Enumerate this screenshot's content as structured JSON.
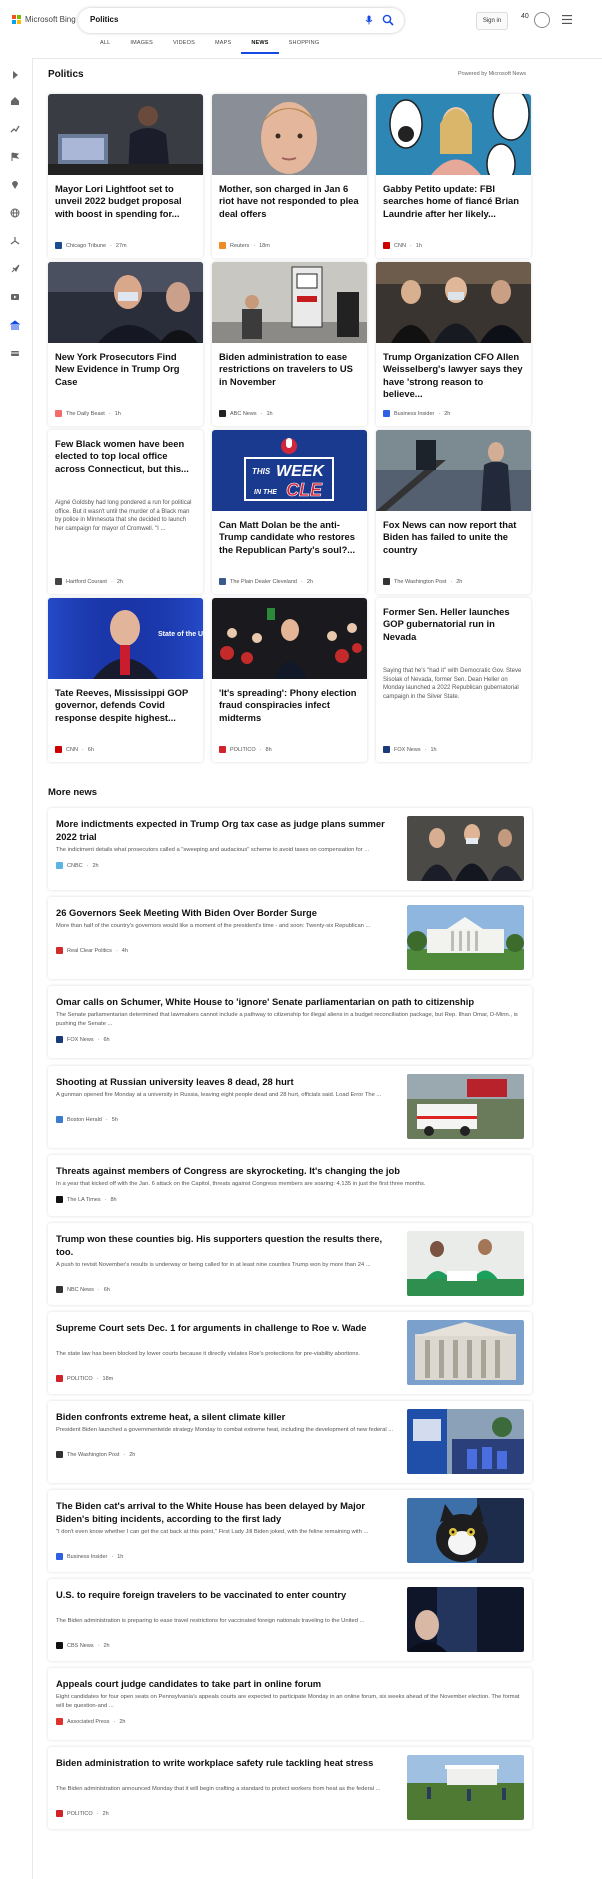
{
  "header": {
    "brand": "Microsoft Bing",
    "query": "Politics",
    "signin": "Sign in",
    "rewards_count": "40",
    "tabs": [
      "ALL",
      "IMAGES",
      "VIDEOS",
      "MAPS",
      "NEWS",
      "SHOPPING"
    ],
    "active_tab": "NEWS"
  },
  "section": {
    "title": "Politics",
    "powered_by": "Powered by Microsoft News"
  },
  "cards": [
    {
      "title": "Mayor Lori Lightfoot set to unveil 2022 budget proposal with boost in spending for...",
      "source": "Chicago Tribune",
      "time": "27m",
      "logo_color": "#1a4d8f",
      "image": "mayor"
    },
    {
      "title": "Mother, son charged in Jan 6 riot have not responded to plea deal offers",
      "source": "Reuters",
      "time": "18m",
      "logo_color": "#f08a24",
      "image": "mugshot"
    },
    {
      "title": "Gabby Petito update: FBI searches home of fiancé Brian Laundrie after her likely...",
      "source": "CNN",
      "time": "1h",
      "logo_color": "#cc0000",
      "image": "petito"
    },
    {
      "title": "New York Prosecutors Find New Evidence in Trump Org Case",
      "source": "The Daily Beast",
      "time": "1h",
      "logo_color": "#f26c6c",
      "image": "weisselberg"
    },
    {
      "title": "Biden administration to ease restrictions on travelers to US in November",
      "source": "ABC News",
      "time": "1h",
      "logo_color": "#222222",
      "image": "testing"
    },
    {
      "title": "Trump Organization CFO Allen Weisselberg's lawyer says they have 'strong reason to believe...",
      "source": "Business Insider",
      "time": "2h",
      "logo_color": "#2f5fe3",
      "image": "lawyers"
    },
    {
      "title": "Few Black women have been elected to top local office across Connecticut, but this...",
      "snippet": "Aigné Goldsby had long pondered a run for political office. But it wasn't until the murder of a Black man by police in Minnesota that she decided to launch her campaign for mayor of Cromwell. \"I ...",
      "source": "Hartford Courant",
      "time": "2h",
      "logo_color": "#444444",
      "image": "none"
    },
    {
      "title": "Can Matt Dolan be the anti-Trump candidate who restores the Republican Party's soul?...",
      "source": "The Plain Dealer Cleveland",
      "time": "2h",
      "logo_color": "#3a5a8c",
      "image": "weekcle",
      "image_text_1": "THIS",
      "image_text_2": "WEEK",
      "image_text_3": "IN THE",
      "image_text_4": "CLE"
    },
    {
      "title": "Fox News can now report that Biden has failed to unite the country",
      "source": "The Washington Post",
      "time": "2h",
      "logo_color": "#333333",
      "image": "biden_stairs"
    },
    {
      "title": "Tate Reeves, Mississippi GOP governor, defends Covid response despite highest...",
      "source": "CNN",
      "time": "6h",
      "logo_color": "#cc0000",
      "image": "stateunion",
      "image_text": "State of the UNION"
    },
    {
      "title": "'It's spreading': Phony election fraud conspiracies infect midterms",
      "source": "POLITICO",
      "time": "8h",
      "logo_color": "#d2232a",
      "image": "rally"
    },
    {
      "title": "Former Sen. Heller launches GOP gubernatorial run in Nevada",
      "snippet": "Saying that he's \"had it\" with Democratic Gov. Steve Sisolak of Nevada, former Sen. Dean Heller on Monday launched a 2022 Republican gubernatorial campaign in the Silver State.",
      "source": "FOX News",
      "time": "1h",
      "logo_color": "#1a3b7a",
      "image": "none"
    }
  ],
  "more_news": {
    "title": "More news",
    "items": [
      {
        "title": "More indictments expected in Trump Org tax case as judge plans summer 2022 trial",
        "snippet": "The indictment details what prosecutors called a \"sweeping and audacious\" scheme to avoid taxes on compensation for ...",
        "source": "CNBC",
        "time": "2h",
        "logo_color": "#5bb4e5",
        "thumb": "suits"
      },
      {
        "title": "26 Governors Seek Meeting With Biden Over Border Surge",
        "snippet": "More than half of the country's governors would like a moment of the president's time - and soon: Twenty-six Republican ...",
        "source": "Real Clear Politics",
        "time": "4h",
        "logo_color": "#d12b2b",
        "thumb": "whitehouse"
      },
      {
        "title": "Omar calls on Schumer, White House to 'ignore' Senate parliamentarian on path to citizenship",
        "snippet": "The Senate parliamentarian determined that lawmakers cannot include a pathway to citizenship for illegal aliens in a budget reconciliation package, but Rep. Ilhan Omar, D-Minn., is pushing the Senate ...",
        "source": "FOX News",
        "time": "6h",
        "logo_color": "#1a3b7a",
        "thumb": "none"
      },
      {
        "title": "Shooting at Russian university leaves 8 dead, 28 hurt",
        "snippet": "A gunman opened fire Monday at a university in Russia, leaving eight people dead and 28 hurt, officials said. Load Error The ...",
        "source": "Boston Herald",
        "time": "5h",
        "logo_color": "#3b7bd0",
        "thumb": "ambulance"
      },
      {
        "title": "Threats against members of Congress are skyrocketing. It's changing the job",
        "snippet": "In a year that kicked off with the Jan. 6 attack on the Capitol, threats against Congress members are soaring: 4,135 in just the first three months.",
        "source": "The LA Times",
        "time": "8h",
        "logo_color": "#111111",
        "thumb": "none"
      },
      {
        "title": "Trump won these counties big. His supporters question the results there, too.",
        "snippet": "A push to revisit November's results is underway or being called for in at least nine counties Trump won by more than 24 ...",
        "source": "NBC News",
        "time": "6h",
        "logo_color": "#333333",
        "thumb": "greenshirts"
      },
      {
        "title": "Supreme Court sets Dec. 1 for arguments in challenge to Roe v. Wade",
        "snippet": "The state law has been blocked by lower courts because it directly violates Roe's protections for pre-viability abortions.",
        "source": "POLITICO",
        "time": "18m",
        "logo_color": "#d2232a",
        "thumb": "court"
      },
      {
        "title": "Biden confronts extreme heat, a silent climate killer",
        "snippet": "President Biden launched a governmentwide strategy Monday to combat extreme heat, including the development of new federal ...",
        "source": "The Washington Post",
        "time": "2h",
        "logo_color": "#333333",
        "thumb": "cooling"
      },
      {
        "title": "The Biden cat's arrival to the White House has been delayed by Major Biden's biting incidents, according to the first lady",
        "snippet": "\"I don't even know whether I can get the cat back at this point,\" First Lady Jill Biden joked, with the feline remaining with ...",
        "source": "Business Insider",
        "time": "1h",
        "logo_color": "#2f5fe3",
        "thumb": "cat"
      },
      {
        "title": "U.S. to require foreign travelers to be vaccinated to enter country",
        "snippet": "The Biden administration is preparing to ease travel restrictions for vaccinated foreign nationals traveling to the United ...",
        "source": "CBS News",
        "time": "2h",
        "logo_color": "#111111",
        "thumb": "biden_dark"
      },
      {
        "title": "Appeals court judge candidates to take part in online forum",
        "snippet": "Eight candidates for four open seats on Pennsylvania's appeals courts are expected to participate Monday in an online forum, six weeks ahead of the November election. The format will be question-and ...",
        "source": "Associated Press",
        "time": "2h",
        "logo_color": "#e0302a",
        "thumb": "none"
      },
      {
        "title": "Biden administration to write workplace safety rule tackling heat stress",
        "snippet": "The Biden administration announced Monday that it will begin crafting a standard to protect workers from heat as the federal ...",
        "source": "POLITICO",
        "time": "2h",
        "logo_color": "#d2232a",
        "thumb": "field"
      }
    ]
  },
  "colors": {
    "accent": "#174ae4",
    "bing_red": "#f25022",
    "bing_green": "#7fba00",
    "bing_blue": "#00a4ef",
    "bing_yellow": "#ffb900"
  }
}
